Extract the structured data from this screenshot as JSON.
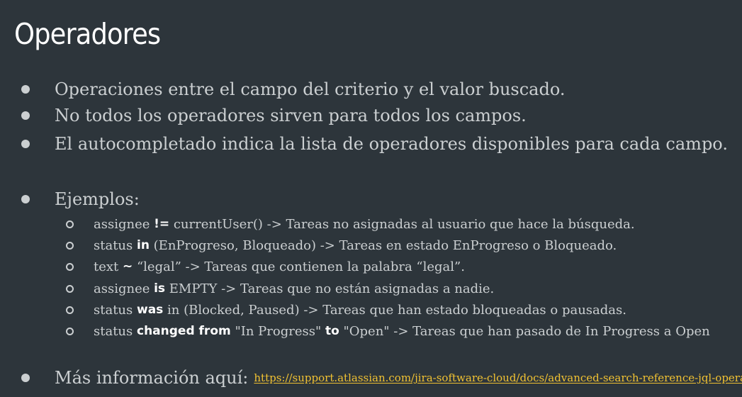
{
  "slide": {
    "title": "Operadores",
    "bullets": [
      "Operaciones entre el campo del criterio y el valor buscado.",
      "No todos los operadores sirven para todos los campos.",
      "El autocompletado indica la lista de operadores disponibles para cada campo."
    ],
    "examples_heading": "Ejemplos:",
    "examples": [
      {
        "pre": "assignee ",
        "op": "!=",
        "post": " currentUser() -> Tareas no asignadas al usuario que hace la búsqueda."
      },
      {
        "pre": "status ",
        "op": "in",
        "post": " (EnProgreso, Bloqueado) -> Tareas en estado EnProgreso o Bloqueado."
      },
      {
        "pre": "text ",
        "op": "~",
        "post": " “legal” -> Tareas que contienen la palabra “legal”."
      },
      {
        "pre": "assignee ",
        "op": "is",
        "post": " EMPTY -> Tareas que no están asignadas a nadie."
      },
      {
        "pre": "status ",
        "op": "was",
        "post": " in (Blocked, Paused) -> Tareas que han estado bloqueadas o pausadas."
      },
      {
        "pre": "status ",
        "op": "changed from",
        "mid": " \"In Progress\" ",
        "op2": "to",
        "post": " \"Open\" -> Tareas que han pasado de In Progress a Open"
      }
    ],
    "more_info_label": "Más información aquí:",
    "more_info_url": "https://support.atlassian.com/jira-software-cloud/docs/advanced-search-reference-jql-operators/"
  }
}
